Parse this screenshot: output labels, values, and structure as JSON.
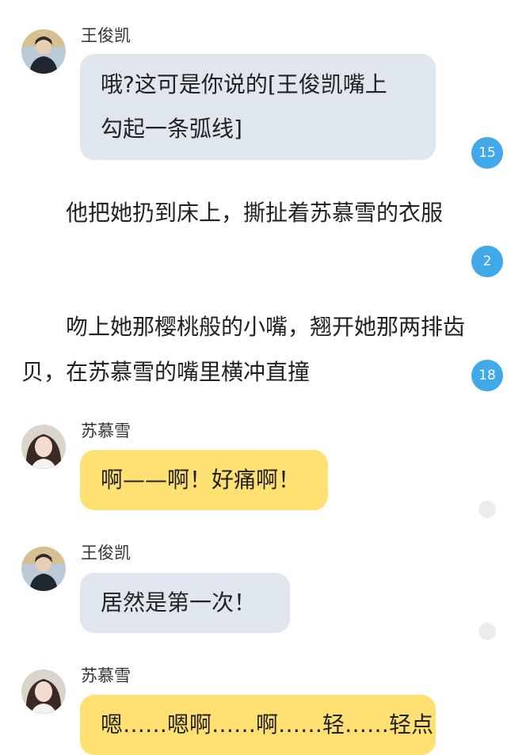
{
  "messages": [
    {
      "speaker": "王俊凯",
      "line1": "哦?这可是你说的[王俊凯嘴上",
      "line2": "勾起一条弧线]",
      "comments": "15"
    },
    {
      "narration": "他把她扔到床上，撕扯着苏慕雪的衣服",
      "comments": "2"
    },
    {
      "narration": "吻上她那樱桃般的小嘴，翘开她那两排齿贝，在苏慕雪的嘴里横冲直撞",
      "comments": "18"
    },
    {
      "speaker": "苏慕雪",
      "text": "啊——啊！好痛啊！"
    },
    {
      "speaker": "王俊凯",
      "text": "居然是第一次！"
    },
    {
      "speaker": "苏慕雪",
      "text": "嗯……嗯啊……啊……轻……轻点"
    }
  ],
  "colors": {
    "bubble_gray": "#e0e6ee",
    "bubble_yellow": "#ffe173",
    "comment_badge": "#41a8ea"
  }
}
